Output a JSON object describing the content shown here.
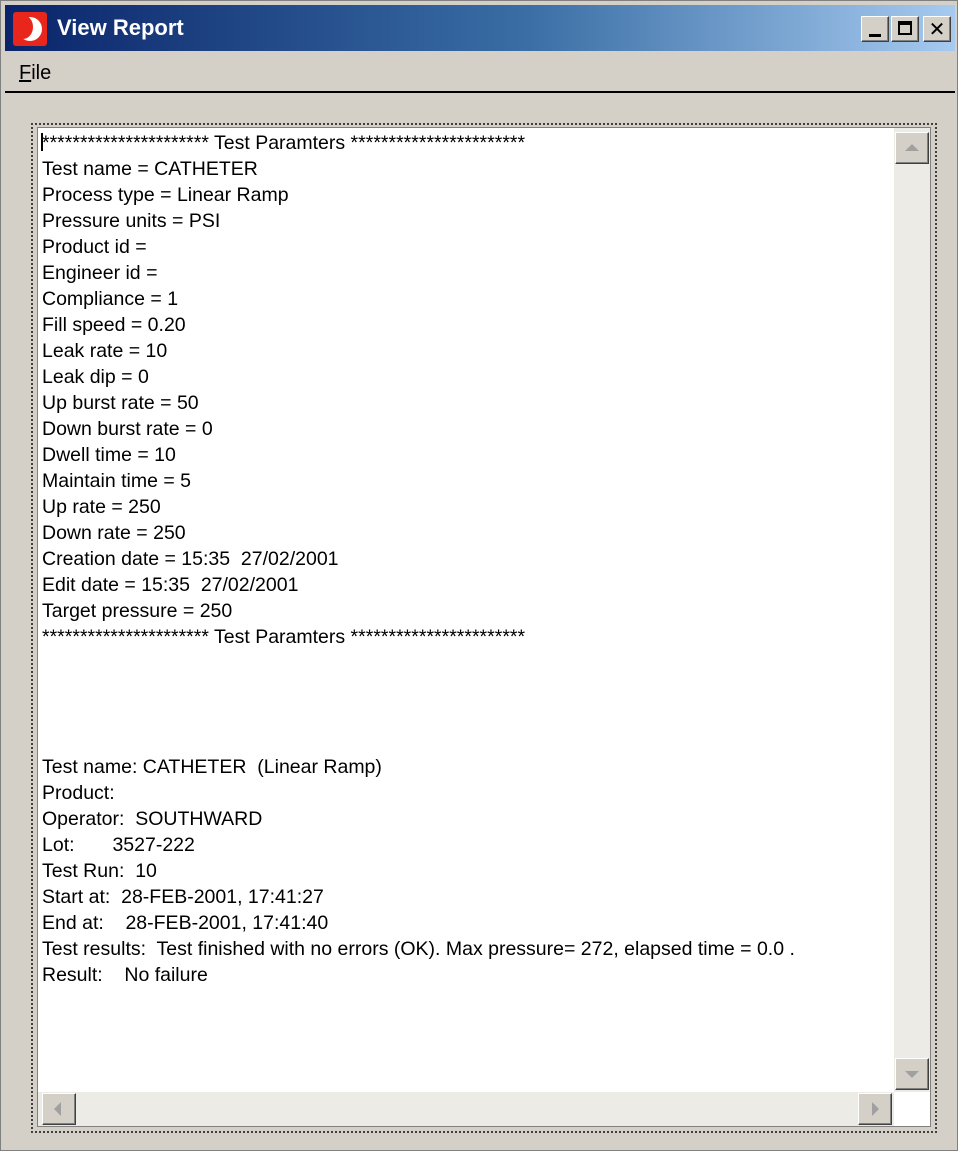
{
  "window": {
    "title": "View Report",
    "icon": "app-logo-icon",
    "controls": {
      "minimize_icon": "minimize-icon",
      "maximize_icon": "maximize-icon",
      "close_icon": "close-icon",
      "close_glyph": "✕"
    },
    "colors": {
      "titlebar_start": "#0a246a",
      "titlebar_end": "#a6caf0",
      "face": "#d4d0c8",
      "icon_red": "#e8261c"
    }
  },
  "menu": {
    "items": [
      {
        "label": "File"
      }
    ]
  },
  "report": {
    "lines": [
      "********************** Test Paramters ***********************",
      "Test name = CATHETER",
      "Process type = Linear Ramp",
      "Pressure units = PSI",
      "Product id =",
      "Engineer id =",
      "Compliance = 1",
      "Fill speed = 0.20",
      "Leak rate = 10",
      "Leak dip = 0",
      "Up burst rate = 50",
      "Down burst rate = 0",
      "Dwell time = 10",
      "Maintain time = 5",
      "Up rate = 250",
      "Down rate = 250",
      "Creation date = 15:35  27/02/2001",
      "Edit date = 15:35  27/02/2001",
      "Target pressure = 250",
      "********************** Test Paramters ***********************",
      "",
      "",
      "",
      "",
      "Test name: CATHETER  (Linear Ramp)",
      "Product:",
      "Operator:  SOUTHWARD",
      "Lot:       3527-222",
      "Test Run:  10",
      "Start at:  28-FEB-2001, 17:41:27",
      "End at:    28-FEB-2001, 17:41:40",
      "Test results:  Test finished with no errors (OK). Max pressure= 272, elapsed time = 0.0 .",
      "Result:    No failure"
    ],
    "scrollbars": {
      "up_icon": "scroll-up-arrow-icon",
      "down_icon": "scroll-down-arrow-icon",
      "left_icon": "scroll-left-arrow-icon",
      "right_icon": "scroll-right-arrow-icon"
    }
  }
}
